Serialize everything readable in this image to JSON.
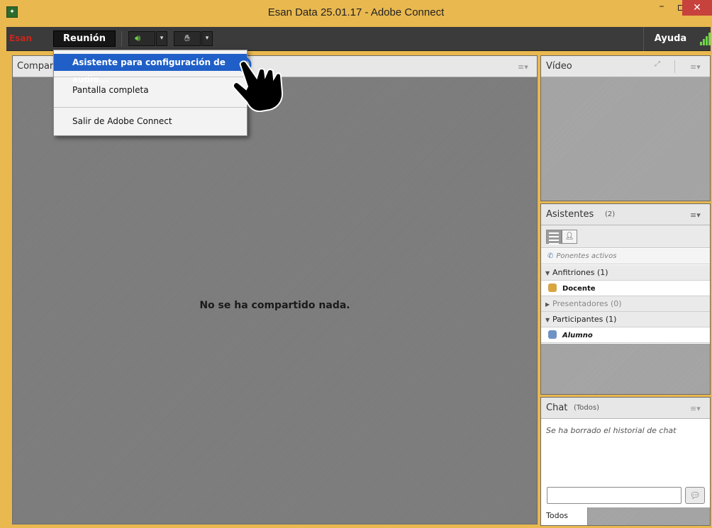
{
  "window": {
    "title": "Esan Data  25.01.17 - Adobe Connect",
    "minimize": "–",
    "close": "✕"
  },
  "menubar": {
    "logo": "Esan",
    "meeting_menu": "Reunión",
    "help": "Ayuda",
    "dropdown_arrow": "▾"
  },
  "dropdown": {
    "items": [
      {
        "label": "Asistente para configuración de audio...",
        "highlighted": true
      },
      {
        "label": "Pantalla completa"
      },
      {
        "label": "Salir de Adobe Connect"
      }
    ]
  },
  "share_pod": {
    "title": "Compart",
    "message": "No se ha compartido nada.",
    "menu_icon": "≡▾"
  },
  "video_pod": {
    "title": "Vídeo",
    "menu_icon": "≡▾"
  },
  "attendees_pod": {
    "title": "Asistentes",
    "count": "(2)",
    "menu_icon": "≡▾",
    "active_speakers": "Ponentes activos",
    "groups": {
      "hosts": {
        "label": "Anfitriones (1)",
        "members": [
          "Docente"
        ]
      },
      "presenters": {
        "label": "Presentadores (0)"
      },
      "participants": {
        "label": "Participantes (1)",
        "members": [
          "Alumno"
        ]
      }
    }
  },
  "chat_pod": {
    "title": "Chat",
    "scope": "(Todos)",
    "menu_icon": "≡▾",
    "history_message": "Se ha borrado el historial de chat",
    "input_value": "",
    "tab_label": "Todos"
  },
  "colors": {
    "window_frame": "#e9b84f",
    "menubar": "#3b3b3b",
    "highlight": "#1f5fc7",
    "close_button": "#c7423c",
    "audio_active": "#6fd64a",
    "logo": "#c8261d"
  },
  "icons": {
    "app": "adobe-connect-app-icon",
    "audio": "speaker-icon",
    "status": "raise-hand-icon",
    "signal": "signal-strength-icon",
    "cursor": "hand-pointer-icon"
  }
}
